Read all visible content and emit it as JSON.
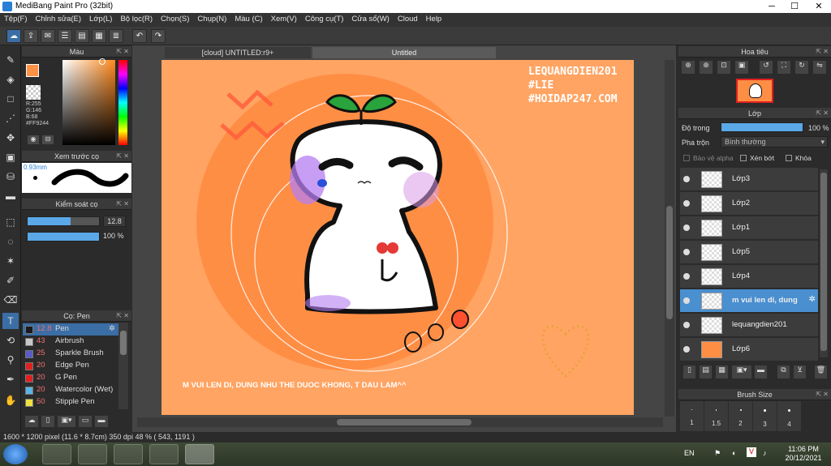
{
  "window": {
    "title": "MediBang Paint Pro (32bit)",
    "controls": {
      "minimize": "─",
      "maximize": "☐",
      "close": "✕"
    }
  },
  "menu": [
    "Tệp(F)",
    "Chỉnh sửa(E)",
    "Lớp(L)",
    "Bộ lọc(R)",
    "Chọn(S)",
    "Chụp(N)",
    "Màu (C)",
    "Xem(V)",
    "Công cụ(T)",
    "Cửa sổ(W)",
    "Cloud",
    "Help"
  ],
  "color_panel": {
    "title": "Màu",
    "rgb": {
      "r": "R:255",
      "g": "G:146",
      "b": "B:68",
      "hex": "#FF9244"
    },
    "foreground": "#FF9244",
    "background": "#ffffff"
  },
  "brush_preview": {
    "title": "Xem trước cọ",
    "size": "0.93mm"
  },
  "brush_control": {
    "title": "Kiểm soát cọ",
    "size": "12.8",
    "opacity": "100 %",
    "size_fill": 0.6,
    "opacity_fill": 1.0
  },
  "brush_list": {
    "title": "Cọ: Pen",
    "items": [
      {
        "size": "12.8",
        "name": "Pen",
        "color": "#1a1a1a"
      },
      {
        "size": "43",
        "name": "Airbrush",
        "color": "#c8c8c8"
      },
      {
        "size": "25",
        "name": "Sparkle Brush",
        "color": "#5a5ac8"
      },
      {
        "size": "20",
        "name": "Edge Pen",
        "color": "#e02020"
      },
      {
        "size": "20",
        "name": "G Pen",
        "color": "#e02020"
      },
      {
        "size": "20",
        "name": "Watercolor (Wet)",
        "color": "#5ab4e6"
      },
      {
        "size": "50",
        "name": "Stipple Pen",
        "color": "#f0e040"
      }
    ]
  },
  "tabs": [
    {
      "label": "[cloud] UNTITLED:r9+"
    },
    {
      "label": "Untitled"
    }
  ],
  "canvas": {
    "watermark_lines": [
      "LEQUANGDIEN201",
      "#LIE",
      "#HOIDAP247.COM"
    ],
    "bottom_text": "M VUI LEN DI, DUNG NHU THE DUOC KHONG, T  DAU LAM^^"
  },
  "navigator": {
    "title": "Hoa tiêu"
  },
  "layers_panel": {
    "title": "Lớp",
    "opacity_label": "Độ trong",
    "opacity_value": "100 %",
    "blend_label": "Pha trộn",
    "blend_value": "Bình thường",
    "protect_alpha": "Bảo vệ alpha",
    "clipping": "Xén bớt",
    "lock": "Khóa",
    "layers": [
      {
        "name": "Lớp3"
      },
      {
        "name": "Lớp2"
      },
      {
        "name": "Lớp1"
      },
      {
        "name": "Lớp5"
      },
      {
        "name": "Lớp4"
      },
      {
        "name": "m vui len di, dung"
      },
      {
        "name": "lequangdien201"
      },
      {
        "name": "Lớp6"
      }
    ]
  },
  "brush_size_panel": {
    "title": "Brush Size",
    "sizes": [
      "1",
      "1.5",
      "2",
      "3",
      "4"
    ]
  },
  "status": {
    "text": "1600 * 1200 pixel   (11.6 * 8.7cm)   350 dpi   48 %   ( 543, 1191 )"
  },
  "taskbar": {
    "lang": "EN",
    "time": "11:06 PM",
    "date": "20/12/2021"
  },
  "colors": {
    "accent": "#4a8fd0",
    "canvas_orange": "#FF9244"
  }
}
